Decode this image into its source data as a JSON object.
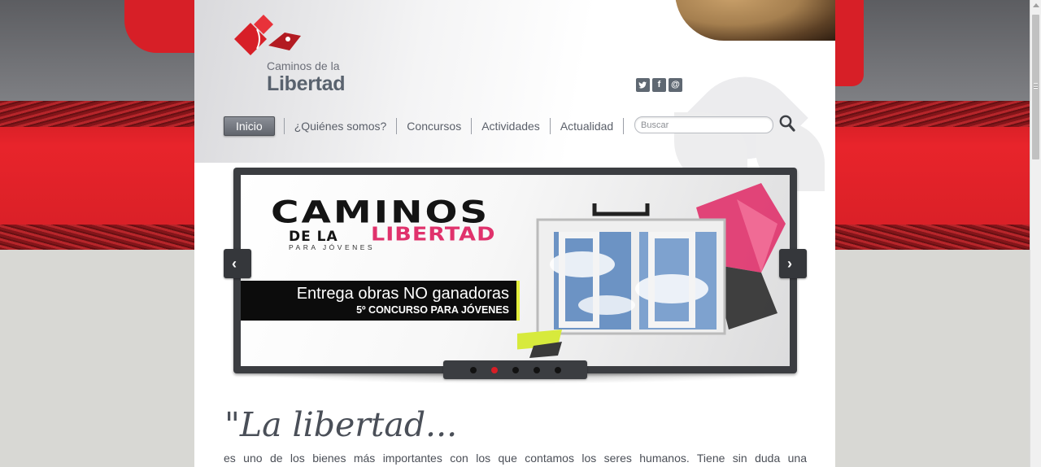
{
  "site": {
    "logo_line1": "Caminos de la",
    "logo_line2": "Libertad"
  },
  "social": [
    {
      "name": "twitter-icon",
      "label": "t"
    },
    {
      "name": "facebook-icon",
      "label": "f"
    },
    {
      "name": "email-icon",
      "label": "@"
    }
  ],
  "nav": {
    "items": [
      {
        "label": "Inicio",
        "active": true
      },
      {
        "label": "¿Quiénes somos?"
      },
      {
        "label": "Concursos"
      },
      {
        "label": "Actividades"
      },
      {
        "label": "Actualidad"
      }
    ]
  },
  "search": {
    "placeholder": "Buscar",
    "value": ""
  },
  "slider": {
    "title": "CAMINOS",
    "pre": "DE LA",
    "sub": "LIBERTAD",
    "small": "PARA JÓVENES",
    "bar_line1": "Entrega obras NO ganadoras",
    "bar_line2": "5º CONCURSO PARA JÓVENES",
    "prev_label": "‹",
    "next_label": "›",
    "dot_count": 5,
    "active_dot": 2
  },
  "content": {
    "quote": "\"La libertad...",
    "body": "es uno de los bienes más importantes con los que contamos los seres humanos. Tiene sin duda una"
  },
  "colors": {
    "brand_red": "#d71f27",
    "nav_text": "#5a5f69",
    "accent_pink": "#e0326c"
  }
}
